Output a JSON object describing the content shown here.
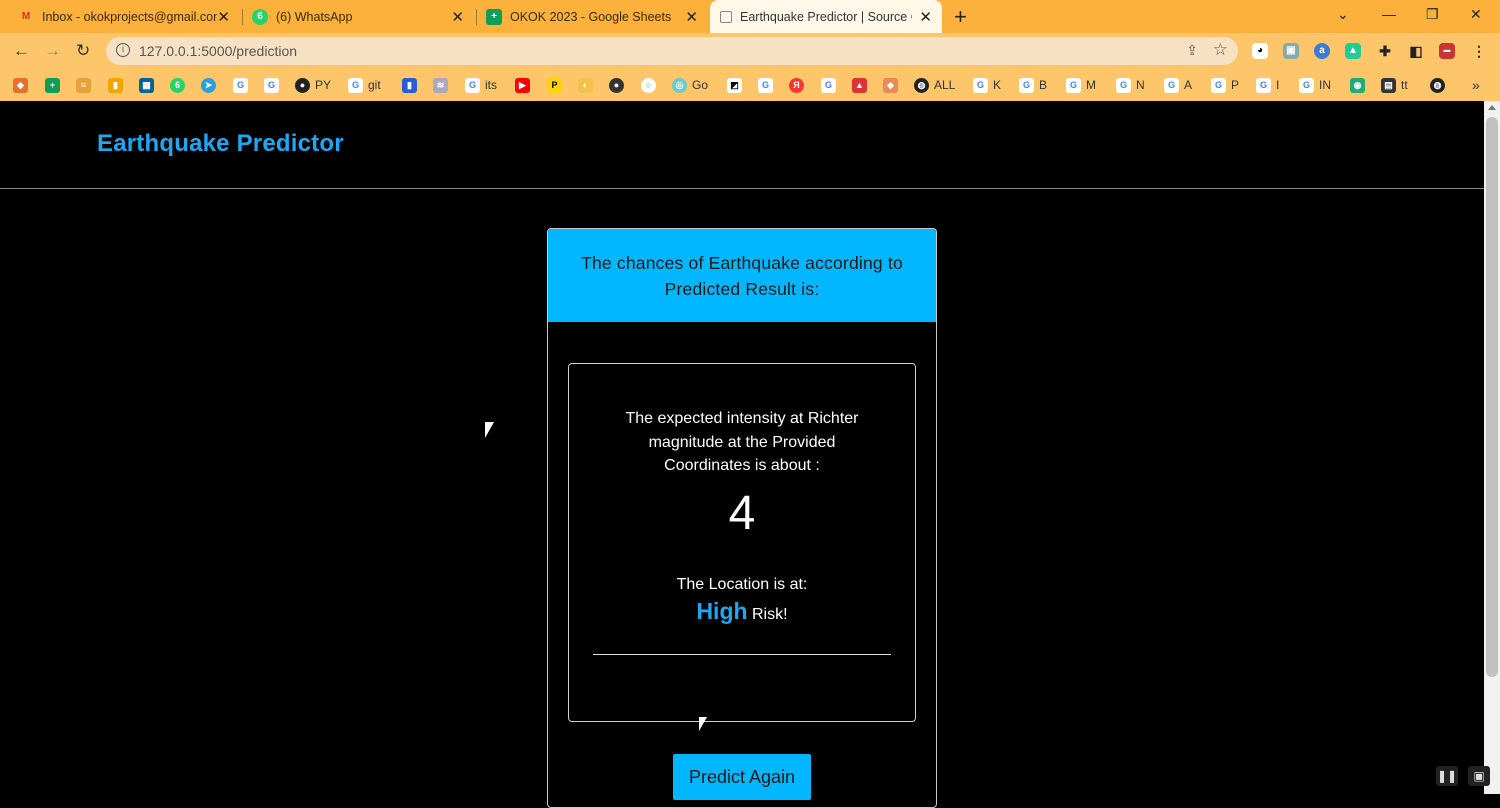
{
  "browser": {
    "tabs": [
      {
        "title": "Inbox - okokprojects@gmail.com",
        "icon": "gmail-icon",
        "icon_glyph": "M",
        "color": "#d93025"
      },
      {
        "title": "(6) WhatsApp",
        "icon": "whatsapp-icon",
        "icon_glyph": "6",
        "color": "#25d366"
      },
      {
        "title": "OKOK 2023 - Google Sheets",
        "icon": "sheets-icon",
        "icon_glyph": "+",
        "color": "#0f9d58"
      },
      {
        "title": "Earthquake Predictor | Source Co",
        "icon": "page-icon",
        "icon_glyph": "▭",
        "color": "#888888"
      }
    ],
    "url": "127.0.0.1:5000/prediction",
    "bookmarks": [
      "PY",
      "git",
      "its",
      "Go",
      "ALL",
      "K",
      "B",
      "M",
      "N",
      "A",
      "P",
      "I",
      "IN",
      "tt"
    ],
    "overflow": "»"
  },
  "app": {
    "brand": "Earthquake Predictor",
    "accent": "#1ea7f2",
    "header_bg": "#00b7ff"
  },
  "card": {
    "heading": "The chances of Earthquake according to Predicted Result is:",
    "intensity_text": "The expected intensity at Richter magnitude at the Provided Coordinates is about :",
    "magnitude": "4",
    "location_label": "The Location is at:",
    "risk_level": "High",
    "risk_suffix": "Risk!",
    "button": "Predict Again"
  }
}
